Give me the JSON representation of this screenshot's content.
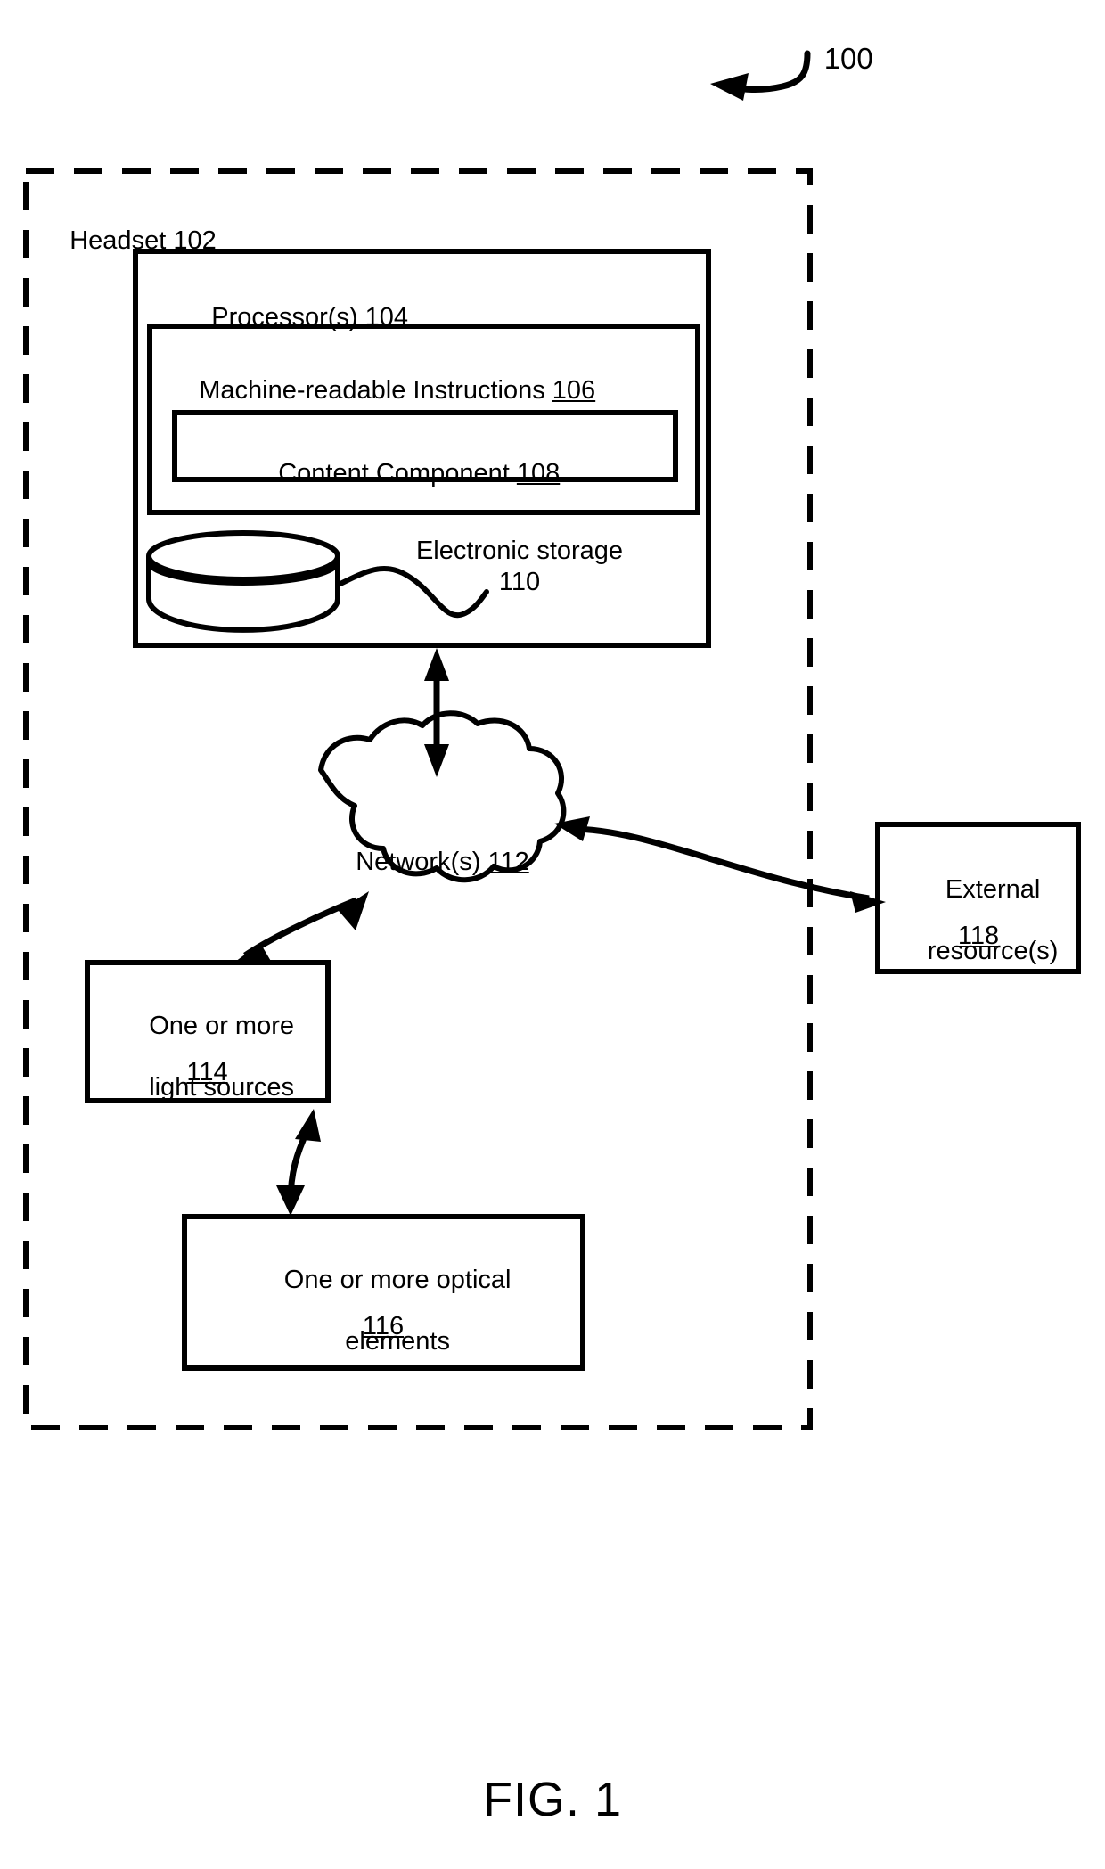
{
  "figure": {
    "caption": "FIG. 1",
    "system_ref": "100"
  },
  "nodes": {
    "headset": {
      "label": "Headset",
      "ref": "102"
    },
    "processor": {
      "label": "Processor(s)",
      "ref": "104"
    },
    "machine_readable_instructions": {
      "label": "Machine-readable Instructions",
      "ref": "106"
    },
    "content_component": {
      "label": "Content Component",
      "ref": "108"
    },
    "electronic_storage": {
      "label": "Electronic storage",
      "ref": "110"
    },
    "network": {
      "label": "Network(s)",
      "ref": "112"
    },
    "light_sources": {
      "line1": "One or more",
      "line2": "light sources",
      "ref": "114"
    },
    "optical_elements": {
      "line1": "One or more optical",
      "line2": "elements",
      "ref": "116"
    },
    "external_resources": {
      "line1": "External",
      "line2": "resource(s)",
      "ref": "118"
    }
  },
  "connections": [
    {
      "from": "processor",
      "to": "network",
      "style": "double-arrow"
    },
    {
      "from": "network",
      "to": "light_sources",
      "style": "double-arrow"
    },
    {
      "from": "network",
      "to": "external_resources",
      "style": "double-arrow"
    },
    {
      "from": "light_sources",
      "to": "optical_elements",
      "style": "double-arrow"
    },
    {
      "from": "electronic_storage",
      "to": "electronic_storage_label",
      "style": "leader-line"
    }
  ],
  "colors": {
    "stroke": "#000000",
    "background": "#ffffff"
  }
}
